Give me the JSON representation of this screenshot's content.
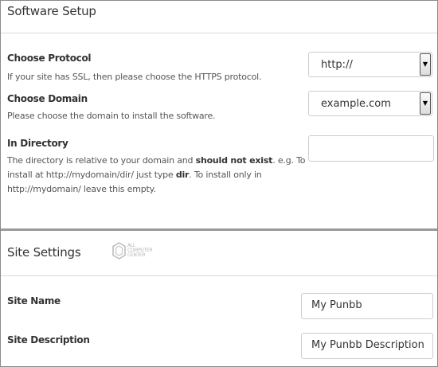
{
  "software_setup": {
    "title": "Software Setup",
    "protocol": {
      "label": "Choose Protocol",
      "help": "If your site has SSL, then please choose the HTTPS protocol.",
      "value": "http://"
    },
    "domain": {
      "label": "Choose Domain",
      "help": "Please choose the domain to install the software.",
      "value": "example.com"
    },
    "directory": {
      "label": "In Directory",
      "help_part1": "The directory is relative to your domain and ",
      "help_bold1": "should not exist",
      "help_part2": ". e.g. To install at http://mydomain/dir/ just type ",
      "help_bold2": "dir",
      "help_part3": ". To install only in http://mydomain/ leave this empty.",
      "value": ""
    }
  },
  "site_settings": {
    "title": "Site Settings",
    "logo": {
      "line1": "ALL",
      "line2": "COMPUTER",
      "line3": "CENTER"
    },
    "site_name": {
      "label": "Site Name",
      "value": "My Punbb"
    },
    "site_description": {
      "label": "Site Description",
      "value": "My Punbb Description"
    }
  },
  "icons": {
    "dropdown_arrow": "triangle-down-icon"
  }
}
